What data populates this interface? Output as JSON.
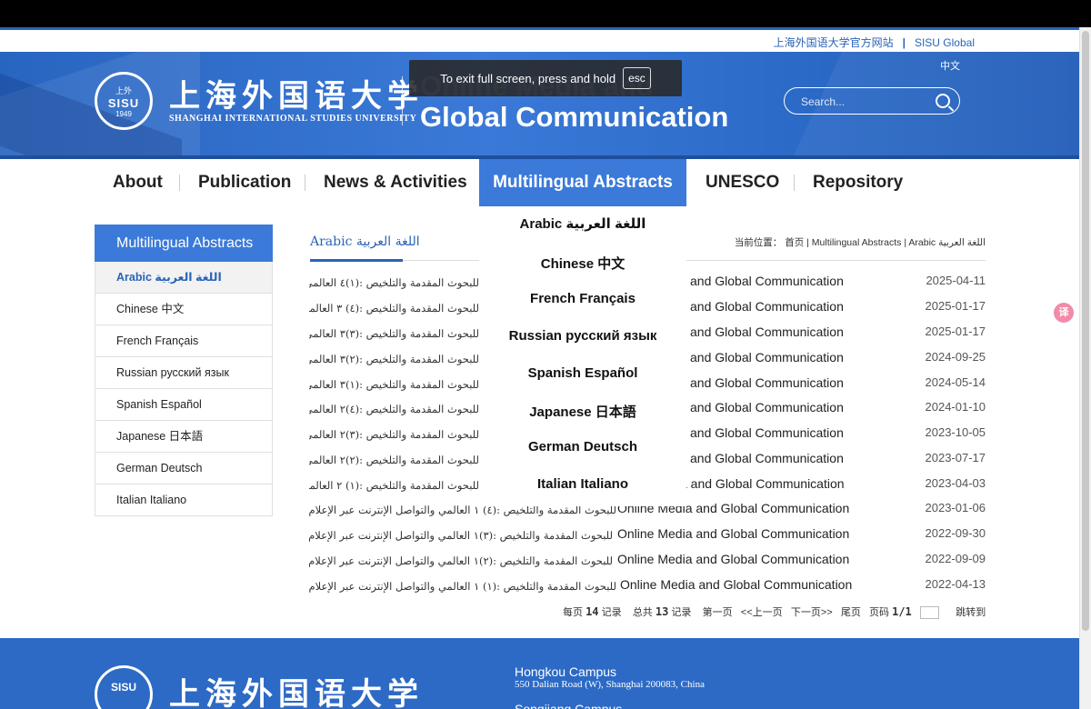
{
  "top_links": {
    "official_site": "上海外国语大学官方网站",
    "separator": "|",
    "sisu_global": "SISU Global"
  },
  "header": {
    "lang_switch": "中文",
    "seal": {
      "top": "上外",
      "middle": "SISU",
      "year": "1949"
    },
    "logo_cn": "上海外国语大学",
    "logo_en": "SHANGHAI INTERNATIONAL STUDIES UNIVERSITY",
    "title_line1": "Online Media and",
    "title_line2": "Global Communication",
    "search_placeholder": "Search..."
  },
  "fullscreen_toast": {
    "message": "To exit full screen, press and hold",
    "key": "esc"
  },
  "nav": [
    "About",
    "Publication",
    "News & Activities",
    "Multilingual Abstracts",
    "UNESCO",
    "Repository"
  ],
  "dropdown": [
    "Arabic اللغة العربية",
    "Chinese 中文",
    "French Français",
    "Russian  русский язык",
    "Spanish Español",
    "Japanese 日本語",
    "German Deutsch",
    "Italian Italiano"
  ],
  "sidebar": {
    "title": "Multilingual Abstracts",
    "items": [
      "Arabic اللغة العربية",
      "Chinese 中文",
      "French Français",
      "Russian  русский язык",
      "Spanish Español",
      "Japanese 日本語",
      "German Deutsch",
      "Italian Italiano"
    ]
  },
  "section": {
    "title": "Arabic اللغة العربية",
    "breadcrumb": "当前位置： 首页 | Multilingual Abstracts | Arabic اللغة العربية"
  },
  "articles": [
    {
      "ar": "للبحوث المقدمة والتلخيص :(١)٤ العالمي ل",
      "en": "and Global Communication",
      "date": "2025-04-11"
    },
    {
      "ar": "للبحوث المقدمة والتلخيص :(٤) ٣ العالمي ل",
      "en": "and Global Communication",
      "date": "2025-01-17"
    },
    {
      "ar": "للبحوث المقدمة والتلخيص :(٣)٣ العالمي ل",
      "en": "and Global Communication",
      "date": "2025-01-17"
    },
    {
      "ar": "للبحوث المقدمة والتلخيص :(٢)٣ العالمي ل",
      "en": "and Global Communication",
      "date": "2024-09-25"
    },
    {
      "ar": "للبحوث المقدمة والتلخيص :(١)٣ العالمي ل",
      "en": "and Global Communication",
      "date": "2024-05-14"
    },
    {
      "ar": "للبحوث المقدمة والتلخيص :(٤)٢ العالمي ل",
      "en": "and Global Communication",
      "date": "2024-01-10"
    },
    {
      "ar": "للبحوث المقدمة والتلخيص :(٣)٢ العالمي ل",
      "en": "and Global Communication",
      "date": "2023-10-05"
    },
    {
      "ar": "للبحوث المقدمة والتلخيص :(٢)٢ العالمي ل",
      "en": "and Global Communication",
      "date": "2023-07-17"
    },
    {
      "ar": "للبحوث المقدمة والتلخيص :(١) ٢ العالمي ل",
      "en": "a and Global Communication",
      "date": "2023-04-03"
    },
    {
      "ar": "للبحوث المقدمة والتلخيص :(٤) ١ العالمي والتواصل الإنترنت عبر الإعلام وسائل",
      "en": "Online Media and Global Communication",
      "date": "2023-01-06"
    },
    {
      "ar": "للبحوث المقدمة والتلخيص :(٣)١ العالمي والتواصل الإنترنت عبر الإعلام وسائل",
      "en": "Online Media and Global Communication",
      "date": "2022-09-30"
    },
    {
      "ar": "للبحوث المقدمة والتلخيص :(٢)١ العالمي والتواصل الإنترنت عبر الإعلام وسائل",
      "en": "Online Media and Global Communication",
      "date": "2022-09-09"
    },
    {
      "ar": "للبحوث المقدمة والتلخيص :(١) ١ العالمي والتواصل الإنترنت عبر الإعلام وسائل",
      "en": "Online Media and Global Communication",
      "date": "2022-04-13"
    }
  ],
  "pager": {
    "per_page_label": "每页",
    "per_page": "14",
    "records_label": "记录",
    "total_label": "总共",
    "total": "13",
    "first": "第一页",
    "prev": "<<上一页",
    "next": "下一页>>",
    "last": "尾页",
    "page_label": "页码",
    "page": "1/1",
    "goto": "跳转到"
  },
  "footer": {
    "seal": "SISU",
    "logo_cn": "上海外国语大学",
    "campus1": "Hongkou Campus",
    "address1": "550 Dalian Road (W), Shanghai 200083, China",
    "campus2": "Songjiang Campus"
  },
  "translate_badge": "译"
}
